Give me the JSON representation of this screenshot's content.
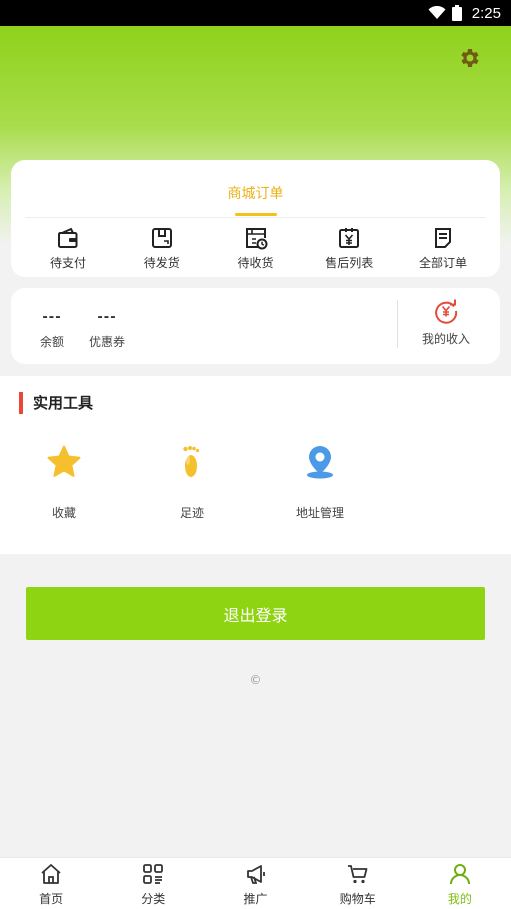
{
  "status_bar": {
    "time": "2:25"
  },
  "orders": {
    "tab_label": "商城订单",
    "items": [
      {
        "label": "待支付",
        "icon": "wallet-icon"
      },
      {
        "label": "待发货",
        "icon": "box-icon"
      },
      {
        "label": "待收货",
        "icon": "delivery-clock-icon"
      },
      {
        "label": "售后列表",
        "icon": "yen-bag-icon"
      },
      {
        "label": "全部订单",
        "icon": "document-icon"
      }
    ]
  },
  "balance": {
    "balance_value": "---",
    "balance_label": "余额",
    "coupon_value": "---",
    "coupon_label": "优惠券",
    "income_label": "我的收入"
  },
  "tools": {
    "title": "实用工具",
    "items": [
      {
        "label": "收藏",
        "icon": "star-icon"
      },
      {
        "label": "足迹",
        "icon": "footprint-icon"
      },
      {
        "label": "地址管理",
        "icon": "location-pin-icon"
      }
    ]
  },
  "logout_label": "退出登录",
  "copyright": "©",
  "tabbar": [
    {
      "label": "首页",
      "icon": "home-icon"
    },
    {
      "label": "分类",
      "icon": "category-icon"
    },
    {
      "label": "推广",
      "icon": "megaphone-icon"
    },
    {
      "label": "购物车",
      "icon": "cart-icon"
    },
    {
      "label": "我的",
      "icon": "user-icon",
      "active": true
    }
  ],
  "colors": {
    "accent": "#8fd413",
    "tab_active": "#f3c21e",
    "tools_marker": "#e9473a"
  }
}
